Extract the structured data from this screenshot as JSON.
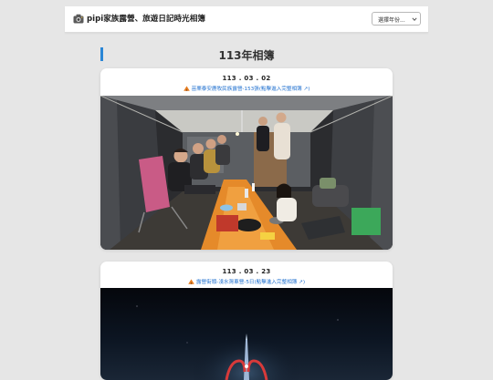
{
  "header": {
    "logo_icon": "camera-icon",
    "site_title": "pipi家族露營、旅遊日記時光相簿",
    "year_select": {
      "selected": "選擇年份...",
      "icon": "chevron-down-icon"
    }
  },
  "page": {
    "heading": "113年相簿"
  },
  "albums": [
    {
      "date": "113 . 03 . 02",
      "link_text": "苗栗泰安鹿牧民族露營-153張(點擊進入完整相簿 ↗)",
      "icon": "tent-icon",
      "photo": "tent-gathering-photo"
    },
    {
      "date": "113 . 03 . 23",
      "link_text": "露營街頭-淺水灣車營-5日(點擊進入完整相簿 ↗)",
      "icon": "tent-icon",
      "photo": "night-landmark-photo"
    }
  ],
  "colors": {
    "accent": "#2a86d6",
    "link": "#1e6fcf",
    "background": "#e6e6e6"
  }
}
